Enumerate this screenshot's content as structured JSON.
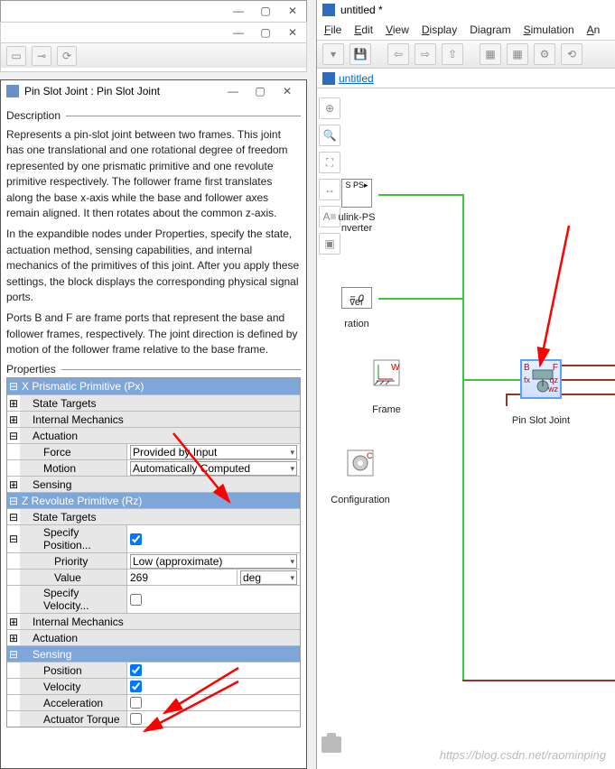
{
  "bg_window": {
    "min": "—",
    "max": "▢",
    "close": "✕"
  },
  "sim": {
    "title": "untitled *",
    "menu": {
      "file": "File",
      "edit": "Edit",
      "view": "View",
      "display": "Display",
      "diagram": "Diagram",
      "simulation": "Simulation",
      "an": "An"
    },
    "tab": "untitled",
    "blocks": {
      "converter": {
        "caption_l1": "ulink-PS",
        "caption_l2": "nverter",
        "port": "S PS"
      },
      "eq0": {
        "text": "= 0",
        "caption_l1": "ver",
        "caption_l2": "ration"
      },
      "world_frame": {
        "w": "W",
        "caption": "Frame"
      },
      "config": {
        "c": "C",
        "caption": "Configuration"
      },
      "pin_slot": {
        "caption": "Pin Slot Joint",
        "b": "B",
        "f": "F",
        "fx": "fx",
        "qz": "qz",
        "wz": "wz"
      }
    }
  },
  "dlg": {
    "title": "Pin Slot Joint : Pin Slot Joint",
    "min": "—",
    "max": "▢",
    "close": "✕",
    "section_desc": "Description",
    "desc_p1": "Represents a pin-slot joint between two frames. This joint has one translational and one rotational degree of freedom represented by one prismatic primitive and one revolute primitive respectively. The follower frame first translates along the base x-axis while the base and follower axes remain aligned. It then rotates about the common z-axis.",
    "desc_p2": "In the expandible nodes under Properties, specify the state, actuation method, sensing capabilities, and internal mechanics of the primitives of this joint. After you apply these settings, the block displays the corresponding physical signal ports.",
    "desc_p3": "Ports B and F are frame ports that represent the base and follower frames, respectively. The joint direction is defined by motion of the follower frame relative to the base frame.",
    "section_props": "Properties",
    "px": {
      "header": "X Prismatic Primitive (Px)",
      "state_targets": "State Targets",
      "internal_mechanics": "Internal Mechanics",
      "actuation": "Actuation",
      "force_lbl": "Force",
      "force_val": "Provided by Input",
      "motion_lbl": "Motion",
      "motion_val": "Automatically Computed",
      "sensing": "Sensing"
    },
    "rz": {
      "header": "Z Revolute Primitive (Rz)",
      "state_targets": "State Targets",
      "spec_pos": "Specify Position...",
      "priority_lbl": "Priority",
      "priority_val": "Low (approximate)",
      "value_lbl": "Value",
      "value_val": "269",
      "value_unit": "deg",
      "spec_vel": "Specify Velocity...",
      "internal_mechanics": "Internal Mechanics",
      "actuation": "Actuation",
      "sensing": "Sensing",
      "position": "Position",
      "velocity": "Velocity",
      "acceleration": "Acceleration",
      "actuator_torque": "Actuator Torque"
    }
  },
  "watermark": "https://blog.csdn.net/raominping"
}
